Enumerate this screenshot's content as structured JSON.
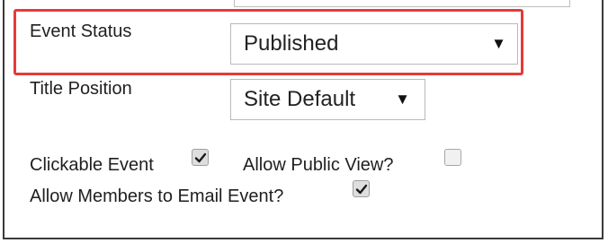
{
  "form": {
    "event_status": {
      "label": "Event Status",
      "selected": "Published"
    },
    "title_position": {
      "label": "Title Position",
      "selected": "Site Default"
    },
    "clickable_event": {
      "label": "Clickable Event",
      "checked": true
    },
    "allow_public_view": {
      "label": "Allow Public View?",
      "checked": false
    },
    "allow_members_email": {
      "label": "Allow Members to Email Event?",
      "checked": true
    }
  },
  "icons": {
    "dropdown": "caret-down-icon",
    "checkbox_checked": "checkmark-icon"
  },
  "colors": {
    "highlight": "#e53a3a",
    "text": "#1f1f1f",
    "field_border": "#b9b9b9"
  }
}
